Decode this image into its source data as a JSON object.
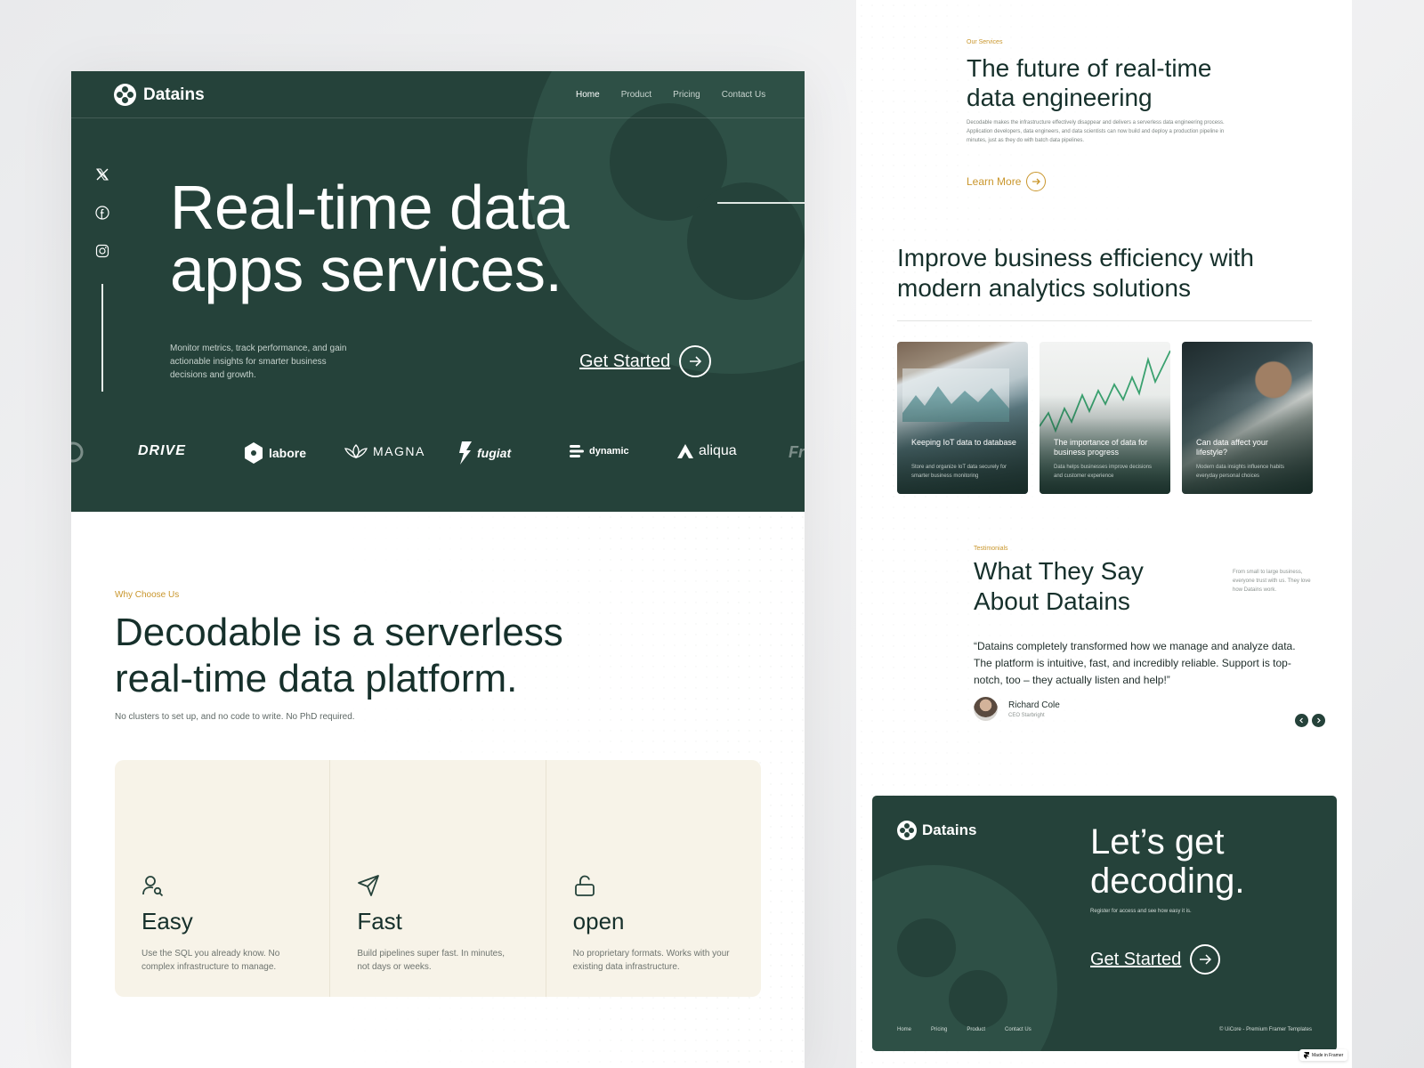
{
  "nav": {
    "logo": "Datains",
    "items": [
      "Home",
      "Product",
      "Pricing",
      "Contact Us"
    ],
    "active": "Home"
  },
  "social": [
    "x-icon",
    "facebook-icon",
    "instagram-icon"
  ],
  "hero": {
    "title_line1": "Real-time data",
    "title_line2": "apps services.",
    "subtitle": "Monitor metrics, track performance, and gain actionable insights for smarter business decisions and growth.",
    "cta": "Get Started"
  },
  "brands": [
    "DRIVE",
    "labore",
    "MAGNA",
    "fugiat",
    "dynamic",
    "aliqua"
  ],
  "why": {
    "eyebrow": "Why Choose Us",
    "title_line1": "Decodable is a serverless",
    "title_line2": "real-time data platform.",
    "subtitle": "No clusters to set up, and no code to write. No PhD required.",
    "features": [
      {
        "icon": "user-search-icon",
        "title": "Easy",
        "desc": "Use the SQL you already know. No complex infrastructure to manage."
      },
      {
        "icon": "send-icon",
        "title": "Fast",
        "desc": "Build pipelines super fast. In minutes, not days or weeks."
      },
      {
        "icon": "unlock-icon",
        "title": "open",
        "desc": "No proprietary formats. Works with your existing data infrastructure."
      }
    ]
  },
  "services": {
    "eyebrow": "Our Services",
    "title_line1": "The future of real-time",
    "title_line2": "data engineering",
    "desc": "Decodable makes the infrastructure effectively disappear and delivers a serverless data engineering process. Application developers, data engineers, and data scientists can now build and deploy a production pipeline in minutes, just as they do with batch data pipelines.",
    "cta": "Learn More"
  },
  "improve": {
    "title_line1": "Improve business efficiency with",
    "title_line2": "modern analytics solutions",
    "cards": [
      {
        "title": "Keeping IoT data to database",
        "desc": "Store and organize IoT data securely for smarter business monitoring"
      },
      {
        "title": "The importance of data for business progress",
        "desc": "Data helps businesses improve decisions and customer experience"
      },
      {
        "title": "Can data affect your lifestyle?",
        "desc": "Modern data insights influence habits everyday personal choices"
      }
    ]
  },
  "testimonials": {
    "eyebrow": "Testimonials",
    "title_line1": "What They Say",
    "title_line2": "About Datains",
    "side": "From small to large business, everyone trust with us. They love how Datains work.",
    "quote": "“Datains completely transformed how we manage and analyze data. The platform is intuitive, fast, and incredibly reliable. Support is top-notch, too – they actually listen and help!”",
    "author": "Richard Cole",
    "role": "CEO Starbright"
  },
  "footer": {
    "logo": "Datains",
    "title_line1": "Let’s get",
    "title_line2": "decoding.",
    "subtitle": "Register for access and see how easy it is.",
    "cta": "Get Started",
    "links": [
      "Home",
      "Pricing",
      "Product",
      "Contact Us"
    ],
    "copyright": "© UiCore - Premium Framer Templates"
  },
  "badge": "Made in Framer",
  "colors": {
    "primary": "#25423a",
    "accent": "#c9962c",
    "cream": "#f7f3e8"
  }
}
